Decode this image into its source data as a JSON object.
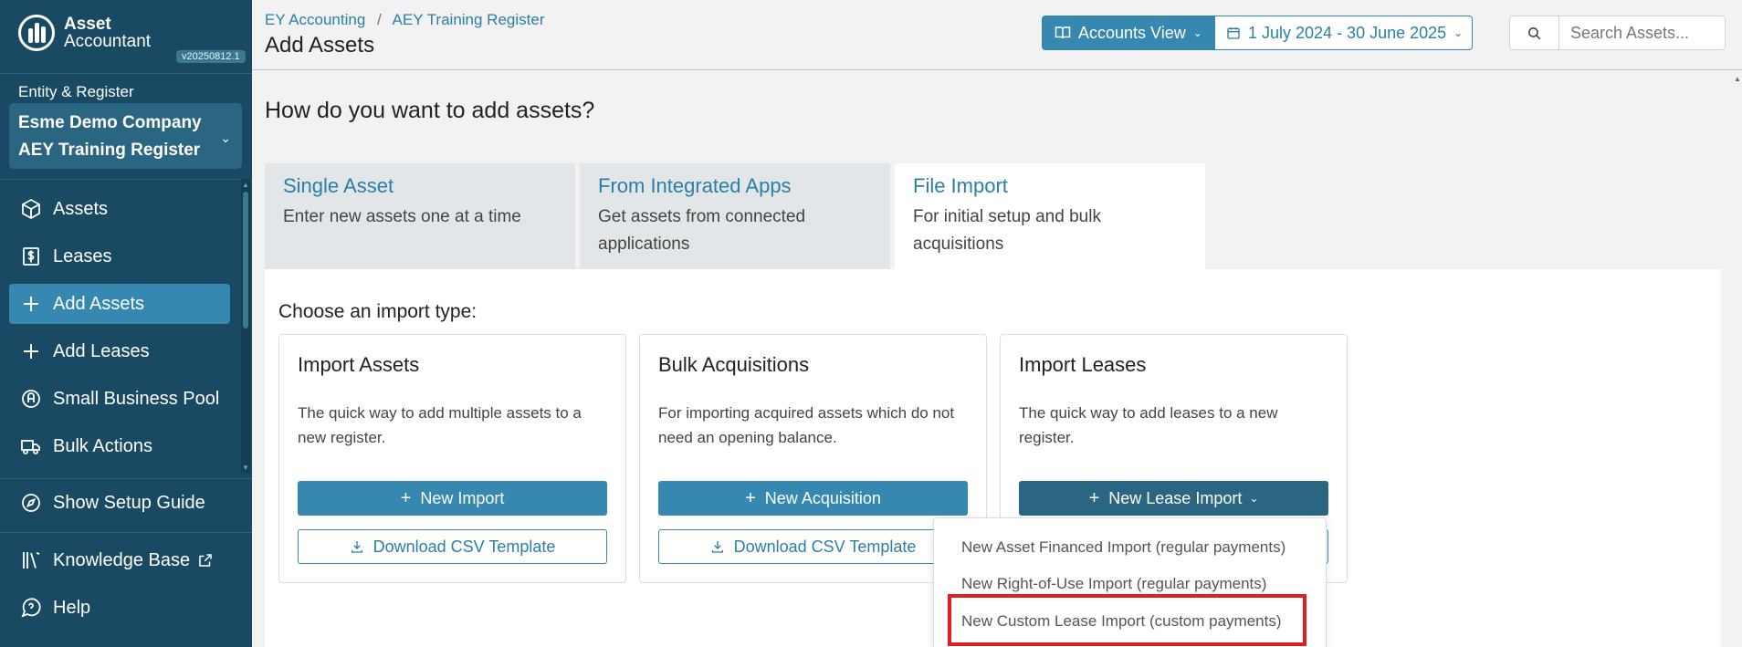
{
  "app": {
    "logo_line1": "Asset",
    "logo_line2": "Accountant",
    "version": "v20250812.1"
  },
  "entity": {
    "label": "Entity & Register",
    "company": "Esme Demo Company",
    "register": "AEY Training Register"
  },
  "nav": {
    "assets": "Assets",
    "leases": "Leases",
    "add_assets": "Add Assets",
    "add_leases": "Add Leases",
    "small_business_pool": "Small Business Pool",
    "bulk_actions": "Bulk Actions",
    "setup_guide": "Show Setup Guide",
    "knowledge_base": "Knowledge Base",
    "help": "Help"
  },
  "header": {
    "breadcrumb_1": "EY Accounting",
    "breadcrumb_sep": "/",
    "breadcrumb_2": "AEY Training Register",
    "title": "Add Assets",
    "accounts_view": "Accounts View",
    "date_range": "1 July 2024 - 30 June 2025",
    "search_placeholder": "Search Assets..."
  },
  "main": {
    "heading": "How do you want to add assets?",
    "tabs": [
      {
        "title": "Single Asset",
        "desc_1": "Enter new assets one at a time",
        "desc_2": ""
      },
      {
        "title": "From Integrated Apps",
        "desc_1": "Get assets from connected",
        "desc_2": "applications"
      },
      {
        "title": "File Import",
        "desc_1": "For initial setup and bulk",
        "desc_2": "acquisitions"
      }
    ],
    "choose_label": "Choose an import type:",
    "cards": [
      {
        "title": "Import Assets",
        "desc": "The quick way to add multiple assets to a new register.",
        "primary": "New Import",
        "secondary": "Download CSV Template"
      },
      {
        "title": "Bulk Acquisitions",
        "desc": "For importing acquired assets which do not need an opening balance.",
        "primary": "New Acquisition",
        "secondary": "Download CSV Template"
      },
      {
        "title": "Import Leases",
        "desc": "The quick way to add leases to a new register.",
        "primary": "New Lease Import"
      }
    ],
    "dropdown": [
      "New Asset Financed Import (regular payments)",
      "New Right-of-Use Import (regular payments)",
      "New Custom Lease Import (custom payments)"
    ]
  },
  "colors": {
    "sidebar": "#1a4a63",
    "accent": "#3688b0",
    "link": "#2b7fa6",
    "highlight": "#e02020"
  }
}
